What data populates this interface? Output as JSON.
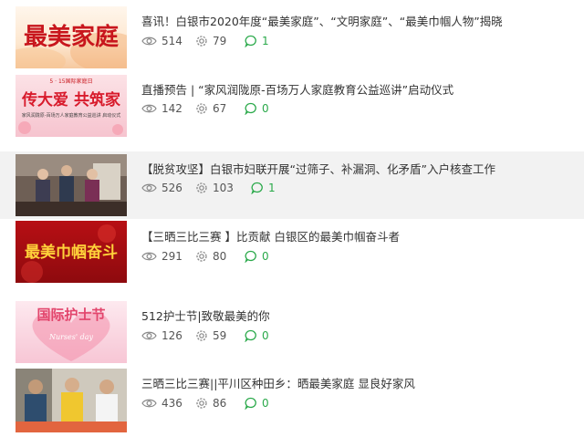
{
  "items": [
    {
      "title": "喜讯！白银市2020年度“最美家庭”、“文明家庭”、“最美巾帼人物”揭晓",
      "views": "514",
      "likes": "79",
      "comments": "1",
      "thumb_text": "最美家庭"
    },
    {
      "title": "直播预告 | “家风润陇原-百场万人家庭教育公益巡讲”启动仪式",
      "views": "142",
      "likes": "67",
      "comments": "0",
      "thumb_text": "传大爱 共筑家",
      "thumb_top": "5 · 15国际家庭日",
      "thumb_sub": "家风润陇原-百场万人家庭教育公益巡讲 启动仪式"
    },
    {
      "title": "【脱贫攻坚】白银市妇联开展“过筛子、补漏洞、化矛盾”入户核查工作",
      "views": "526",
      "likes": "103",
      "comments": "1"
    },
    {
      "title": "【三晒三比三赛 】比贡献 白银区的最美巾帼奋斗者",
      "views": "291",
      "likes": "80",
      "comments": "0",
      "thumb_text": "最美巾帼奋斗"
    },
    {
      "title": "512护士节|致敬最美的你",
      "views": "126",
      "likes": "59",
      "comments": "0",
      "thumb_text": "国际护士节",
      "thumb_sub": "Nurses' day"
    },
    {
      "title": "三晒三比三赛||平川区种田乡：晒最美家庭 显良好家风",
      "views": "436",
      "likes": "86",
      "comments": "0"
    }
  ],
  "colors": {
    "comment_green": "#2aa94a",
    "text": "#333333",
    "highlight_row": "#f2f2f2"
  },
  "icons": {
    "views": "eye-icon",
    "likes": "gear-icon",
    "comments": "speech-bubble-icon"
  }
}
